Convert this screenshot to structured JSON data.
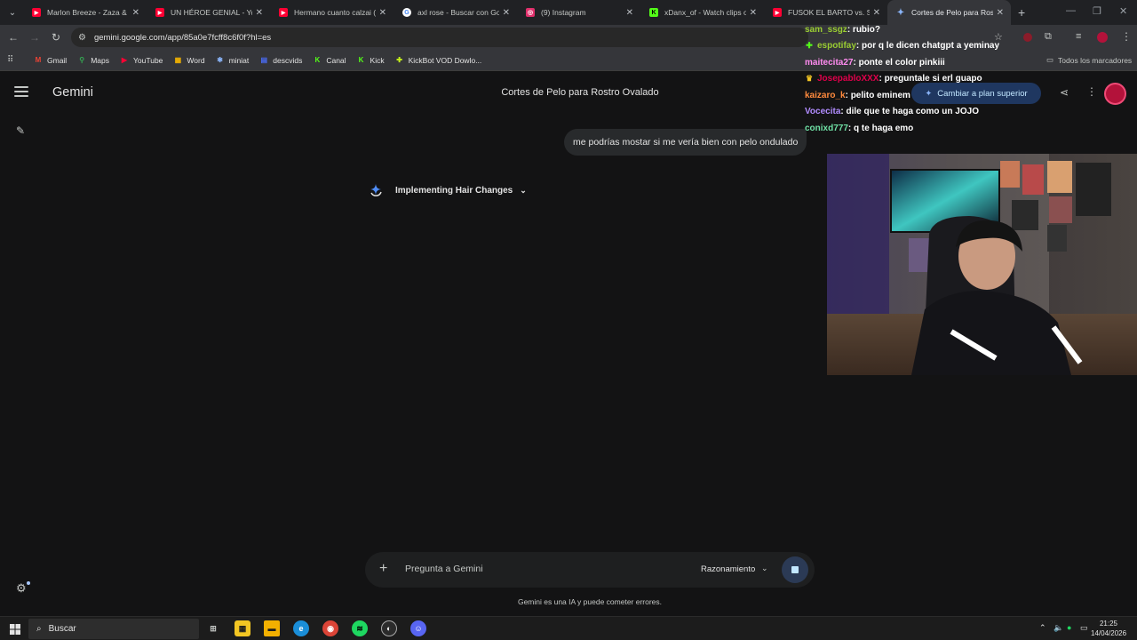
{
  "browser": {
    "tabs": [
      {
        "title": "Marlon Breeze - Zaza & L",
        "favicon": "youtube-icon",
        "color": "#ff0033"
      },
      {
        "title": "UN HÉROE GENIAL - YouT",
        "favicon": "youtube-icon",
        "color": "#ff0033"
      },
      {
        "title": "Hermano cuanto calzai (K",
        "favicon": "youtube-icon",
        "color": "#ff0033"
      },
      {
        "title": "axl rose - Buscar con Goo",
        "favicon": "google-icon",
        "color": "#ffffff"
      },
      {
        "title": "(9) Instagram",
        "favicon": "instagram-icon",
        "color": "#e1306c"
      },
      {
        "title": "xDanx_of - Watch clips on",
        "favicon": "kick-icon",
        "color": "#53fc18"
      },
      {
        "title": "FUSOK EL BARTO vs. SUM",
        "favicon": "youtube-icon",
        "color": "#ff0033"
      },
      {
        "title": "Cortes de Pelo para Rostr",
        "favicon": "gemini-icon",
        "color": "#8ab4f8",
        "active": true
      }
    ],
    "url": "gemini.google.com/app/85a0e7fcff8c6f0f?hl=es",
    "bookmarks": [
      {
        "label": "Gmail",
        "icon": "gmail-icon"
      },
      {
        "label": "Maps",
        "icon": "maps-icon"
      },
      {
        "label": "YouTube",
        "icon": "youtube-icon"
      },
      {
        "label": "Word",
        "icon": "word-icon"
      },
      {
        "label": "miniat",
        "icon": "miniat-icon"
      },
      {
        "label": "descvids",
        "icon": "descvids-icon"
      },
      {
        "label": "Canal",
        "icon": "kick-icon"
      },
      {
        "label": "Kick",
        "icon": "kick-icon"
      },
      {
        "label": "KickBot VOD Dowlo...",
        "icon": "kickbot-icon"
      }
    ],
    "all_bookmarks": "Todos los marcadores"
  },
  "gemini": {
    "app_name": "Gemini",
    "conversation_title": "Cortes de Pelo para Rostro Ovalado",
    "upgrade_label": "Cambiar a plan superior",
    "user_message": "me podrías mostar si me vería bien con pelo ondulado",
    "thinking_label": "Implementing Hair Changes",
    "input_placeholder": "Pregunta a Gemini",
    "mode_label": "Razonamiento",
    "disclaimer": "Gemini es una IA y puede cometer errores."
  },
  "stream_chat": [
    {
      "user": "sam_ssgz",
      "color": "#9acd32",
      "msg": ": rubio?",
      "badge": ""
    },
    {
      "user": "espotifay",
      "color": "#9acd32",
      "msg": ": por q le dicen chatgpt a yeminay",
      "badge": "sparkle"
    },
    {
      "user": "maitecita27",
      "color": "#ff8cf0",
      "msg": ": ponte el color pinkiii",
      "badge": ""
    },
    {
      "user": "JosepabloXXX",
      "color": "#e0004b",
      "msg": ": preguntale si erl guapo",
      "badge": "crown"
    },
    {
      "user": "kaizaro_k",
      "color": "#ff8a3d",
      "msg": ": pelito eminem",
      "badge": ""
    },
    {
      "user": "Vocecita",
      "color": "#b18cff",
      "msg": ": dile que te haga como un JOJO",
      "badge": ""
    },
    {
      "user": "conixd777",
      "color": "#6fe0a5",
      "msg": ": q te haga emo",
      "badge": ""
    }
  ],
  "taskbar": {
    "search_label": "Buscar",
    "time": "21:25",
    "date": "14/04/2026"
  }
}
